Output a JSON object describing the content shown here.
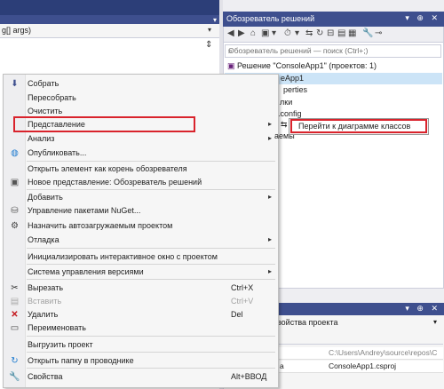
{
  "editor": {
    "nav_text": "g[] args)"
  },
  "solution_explorer": {
    "title": "Обозреватель решений",
    "title_buttons": "▾ ⊕ ✕",
    "search_placeholder": "Обозреватель решений — поиск (Ctrl+;)",
    "tree": {
      "solution": "Решение \"ConsoleApp1\"  (проектов: 1)",
      "project": "eApp1",
      "properties": "perties",
      "references": "лки",
      "config": ".config"
    }
  },
  "properties": {
    "title_buttons": "▾ ⊕ ✕",
    "header": "войства проекта",
    "rows": [
      {
        "key": "",
        "value": "C:\\Users\\Andrey\\source\\repos\\C"
      },
      {
        "key": "a",
        "value": "ConsoleApp1.csproj"
      }
    ]
  },
  "context_menu": {
    "items": [
      {
        "label": "Собрать",
        "icon": "build-icon"
      },
      {
        "label": "Пересобрать"
      },
      {
        "label": "Очистить"
      },
      {
        "label": "Представление",
        "submenu": true
      },
      {
        "label": "Анализ",
        "submenu": true
      },
      {
        "label": "Опубликовать...",
        "icon": "globe-icon"
      },
      {
        "label": "Открыть элемент как корень обозревателя"
      },
      {
        "label": "Новое представление: Обозреватель решений",
        "icon": "new-view-icon"
      },
      {
        "label": "Добавить",
        "submenu": true
      },
      {
        "label": "Управление пакетами NuGet...",
        "icon": "nuget-icon"
      },
      {
        "label": "Назначить автозагружаемым проектом",
        "icon": "gear-icon"
      },
      {
        "label": "Отладка",
        "submenu": true
      },
      {
        "label": "Инициализировать интерактивное окно с проектом"
      },
      {
        "label": "Система управления версиями",
        "submenu": true
      },
      {
        "label": "Вырезать",
        "shortcut": "Ctrl+X",
        "icon": "scissors-icon"
      },
      {
        "label": "Вставить",
        "shortcut": "Ctrl+V",
        "icon": "paste-icon",
        "disabled": true
      },
      {
        "label": "Удалить",
        "shortcut": "Del",
        "icon": "delete-icon"
      },
      {
        "label": "Переименовать",
        "icon": "rename-icon"
      },
      {
        "label": "Выгрузить проект"
      },
      {
        "label": "Открыть папку в проводнике",
        "icon": "open-folder-icon"
      },
      {
        "label": "Свойства",
        "shortcut": "Alt+ВВОД",
        "icon": "wrench-icon"
      }
    ]
  },
  "submenu": {
    "item": "Перейти к диаграмме классов",
    "behind_text": "аемы"
  },
  "colors": {
    "accent": "#3e4f8e",
    "highlight_border": "#d9232c",
    "selection": "#cce4f7"
  }
}
